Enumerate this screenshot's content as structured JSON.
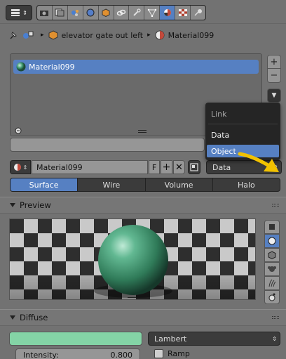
{
  "breadcrumb": {
    "object_name": "elevator gate out left",
    "material_name": "Material099"
  },
  "material_slots": {
    "items": [
      {
        "label": "Material099"
      }
    ]
  },
  "datablock": {
    "material_name": "Material099",
    "fake_user_label": "F",
    "link_selected": "Data"
  },
  "link_dropdown": {
    "title": "Link",
    "options": [
      {
        "label": "Data"
      },
      {
        "label": "Object"
      }
    ]
  },
  "render_tabs": [
    {
      "label": "Surface",
      "active": true
    },
    {
      "label": "Wire"
    },
    {
      "label": "Volume"
    },
    {
      "label": "Halo"
    }
  ],
  "preview_panel": {
    "title": "Preview"
  },
  "diffuse_panel": {
    "title": "Diffuse",
    "color": "#84d4a6",
    "shader": "Lambert",
    "intensity_label": "Intensity:",
    "intensity_value": "0.800",
    "ramp_label": "Ramp"
  },
  "colors": {
    "accent": "#5680c2",
    "arrow": "#f2c200"
  }
}
